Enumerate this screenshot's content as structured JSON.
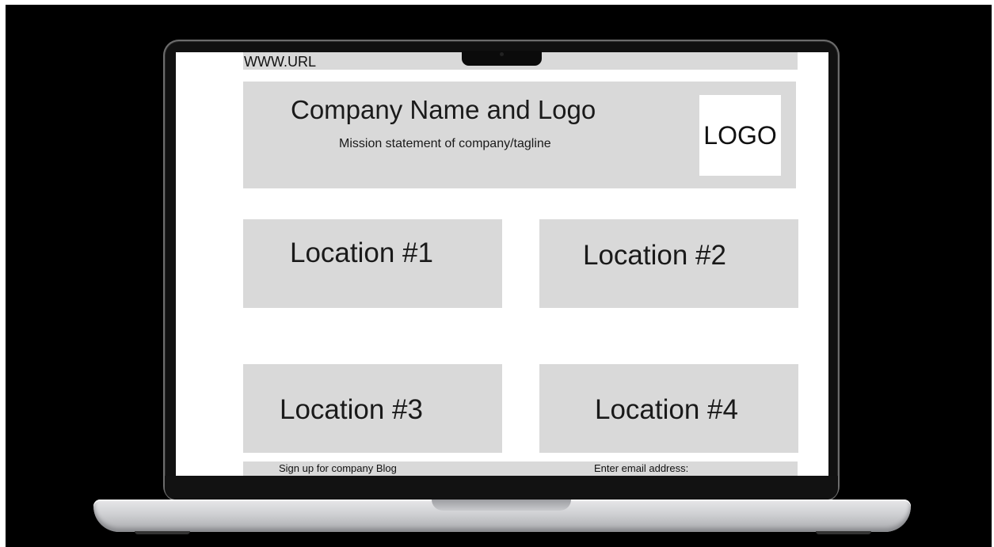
{
  "browser": {
    "url": "WWW.URL"
  },
  "header": {
    "company_name": "Company Name and Logo",
    "tagline": "Mission statement of company/tagline",
    "logo_label": "LOGO"
  },
  "locations": [
    {
      "label": "Location #1"
    },
    {
      "label": "Location #2"
    },
    {
      "label": "Location #3"
    },
    {
      "label": "Location #4"
    }
  ],
  "footer": {
    "signup_label": "Sign up for company Blog",
    "email_label": "Enter email address:"
  }
}
